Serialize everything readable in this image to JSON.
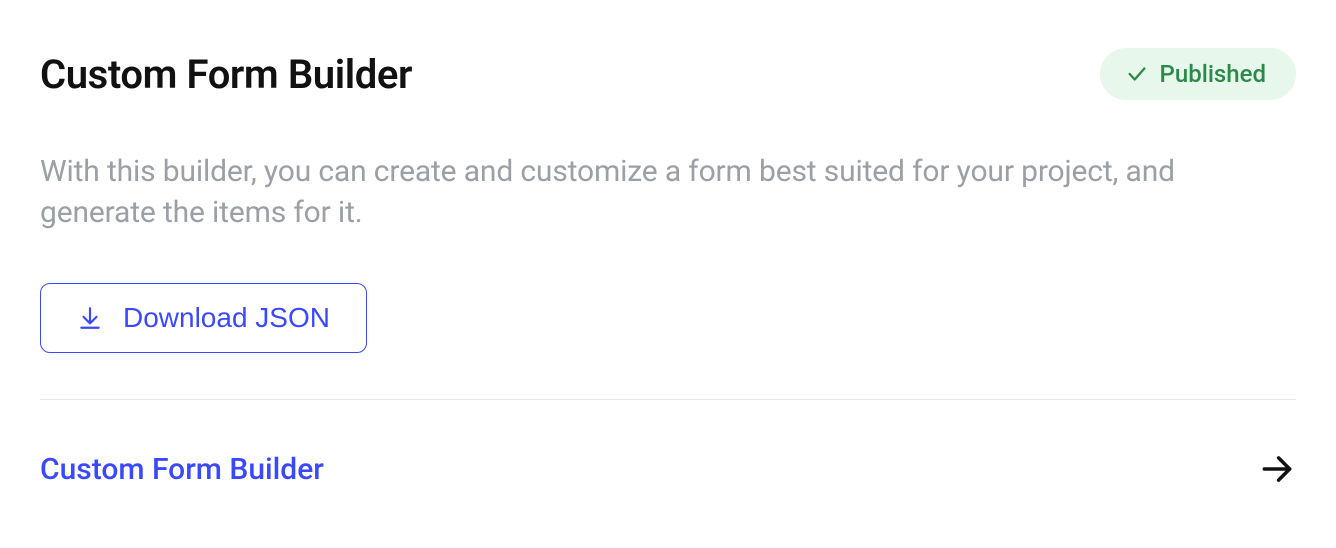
{
  "header": {
    "title": "Custom Form Builder",
    "status_label": "Published",
    "status_color": "#2b8a4a",
    "status_bg": "#e7f7ec"
  },
  "description": "With this builder, you can create and customize a form best suited for your project, and generate the items for it.",
  "actions": {
    "download_label": "Download JSON"
  },
  "link": {
    "label": "Custom Form Builder"
  },
  "colors": {
    "accent": "#3a49ff"
  }
}
